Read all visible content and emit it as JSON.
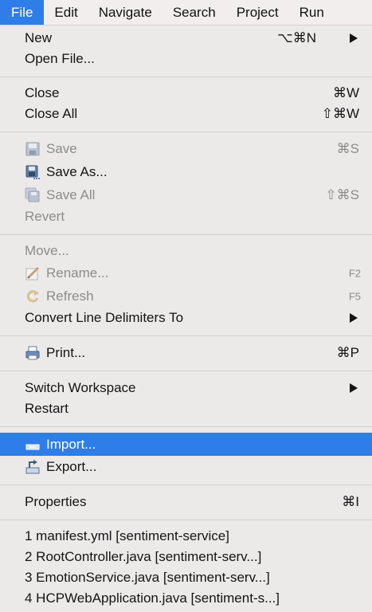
{
  "menubar": {
    "items": [
      "File",
      "Edit",
      "Navigate",
      "Search",
      "Project",
      "Run"
    ]
  },
  "menu": {
    "new": {
      "label": "New",
      "shortcut": "⌥⌘N"
    },
    "open_file": {
      "label": "Open File..."
    },
    "close": {
      "label": "Close",
      "shortcut": "⌘W"
    },
    "close_all": {
      "label": "Close All",
      "shortcut": "⇧⌘W"
    },
    "save": {
      "label": "Save",
      "shortcut": "⌘S"
    },
    "save_as": {
      "label": "Save As..."
    },
    "save_all": {
      "label": "Save All",
      "shortcut": "⇧⌘S"
    },
    "revert": {
      "label": "Revert"
    },
    "move": {
      "label": "Move..."
    },
    "rename": {
      "label": "Rename...",
      "shortcut": "F2"
    },
    "refresh": {
      "label": "Refresh",
      "shortcut": "F5"
    },
    "convert": {
      "label": "Convert Line Delimiters To"
    },
    "print": {
      "label": "Print...",
      "shortcut": "⌘P"
    },
    "switch_workspace": {
      "label": "Switch Workspace"
    },
    "restart": {
      "label": "Restart"
    },
    "import": {
      "label": "Import..."
    },
    "export": {
      "label": "Export..."
    },
    "properties": {
      "label": "Properties",
      "shortcut": "⌘I"
    },
    "recent": [
      "1 manifest.yml  [sentiment-service]",
      "2 RootController.java  [sentiment-serv...]",
      "3 EmotionService.java  [sentiment-serv...]",
      "4 HCPWebApplication.java  [sentiment-s...]"
    ]
  },
  "colors": {
    "highlight": "#2e7de9",
    "menu_bg": "#ece9e9",
    "disabled_text": "#8e8b8b"
  }
}
